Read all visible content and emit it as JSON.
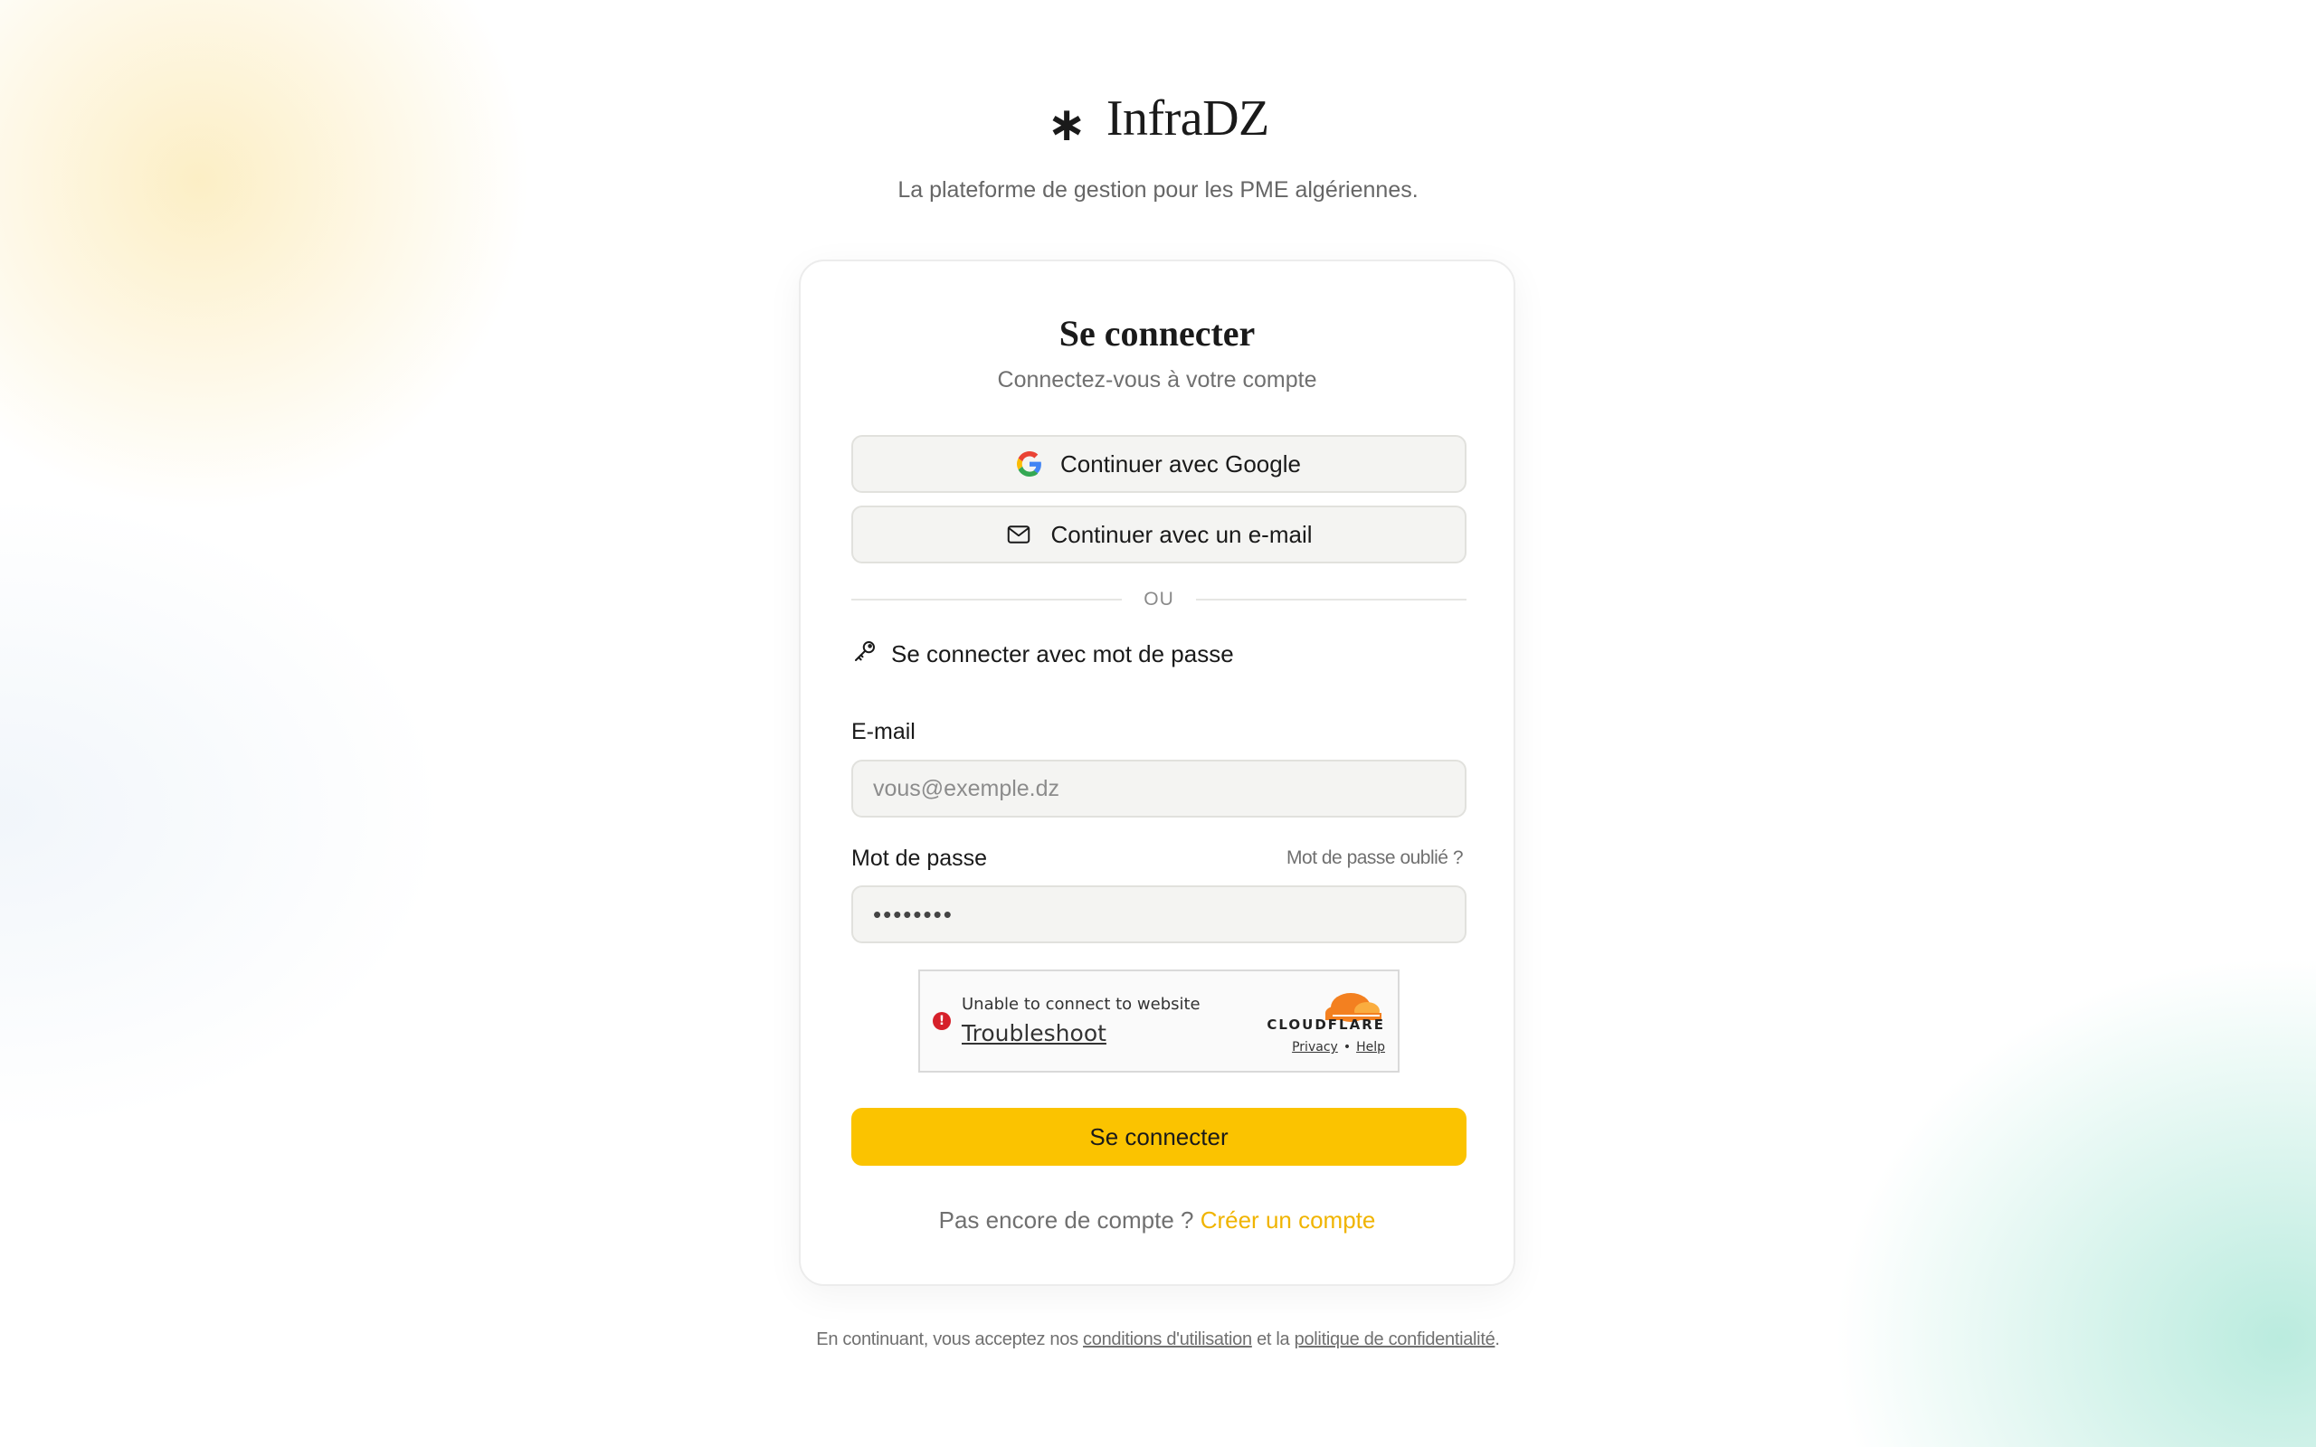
{
  "brand": {
    "mark": "∗",
    "name": "InfraDZ",
    "tagline": "La plateforme de gestion pour les PME algériennes."
  },
  "card": {
    "title": "Se connecter",
    "subtitle": "Connectez-vous à votre compte"
  },
  "oauth": {
    "google_label": "Continuer avec Google",
    "email_label": "Continuer avec un e-mail"
  },
  "divider": {
    "label": "OU"
  },
  "password_mode": {
    "label": "Se connecter avec mot de passe"
  },
  "form": {
    "email_label": "E-mail",
    "email_placeholder": "vous@exemple.dz",
    "password_label": "Mot de passe",
    "forgot_label": "Mot de passe oublié ?",
    "password_value": "••••••••",
    "submit_label": "Se connecter"
  },
  "captcha": {
    "message": "Unable to connect to website",
    "troubleshoot": "Troubleshoot",
    "brand": "CLOUDFLARE",
    "privacy": "Privacy",
    "separator": "•",
    "help": "Help"
  },
  "signup": {
    "prompt": "Pas encore de compte ?",
    "link": "Créer un compte"
  },
  "footer": {
    "prefix": "En continuant, vous acceptez nos",
    "terms": "conditions d'utilisation",
    "middle": "et la",
    "privacy": "politique de confidentialité",
    "suffix": "."
  },
  "colors": {
    "accent": "#fbc300",
    "accent_link": "#f0b400",
    "error": "#d6202a"
  },
  "icons": {
    "google": "google-icon",
    "email": "mail-icon",
    "password": "key-icon",
    "captcha_error": "error-icon",
    "captcha_logo": "cloudflare-logo"
  }
}
